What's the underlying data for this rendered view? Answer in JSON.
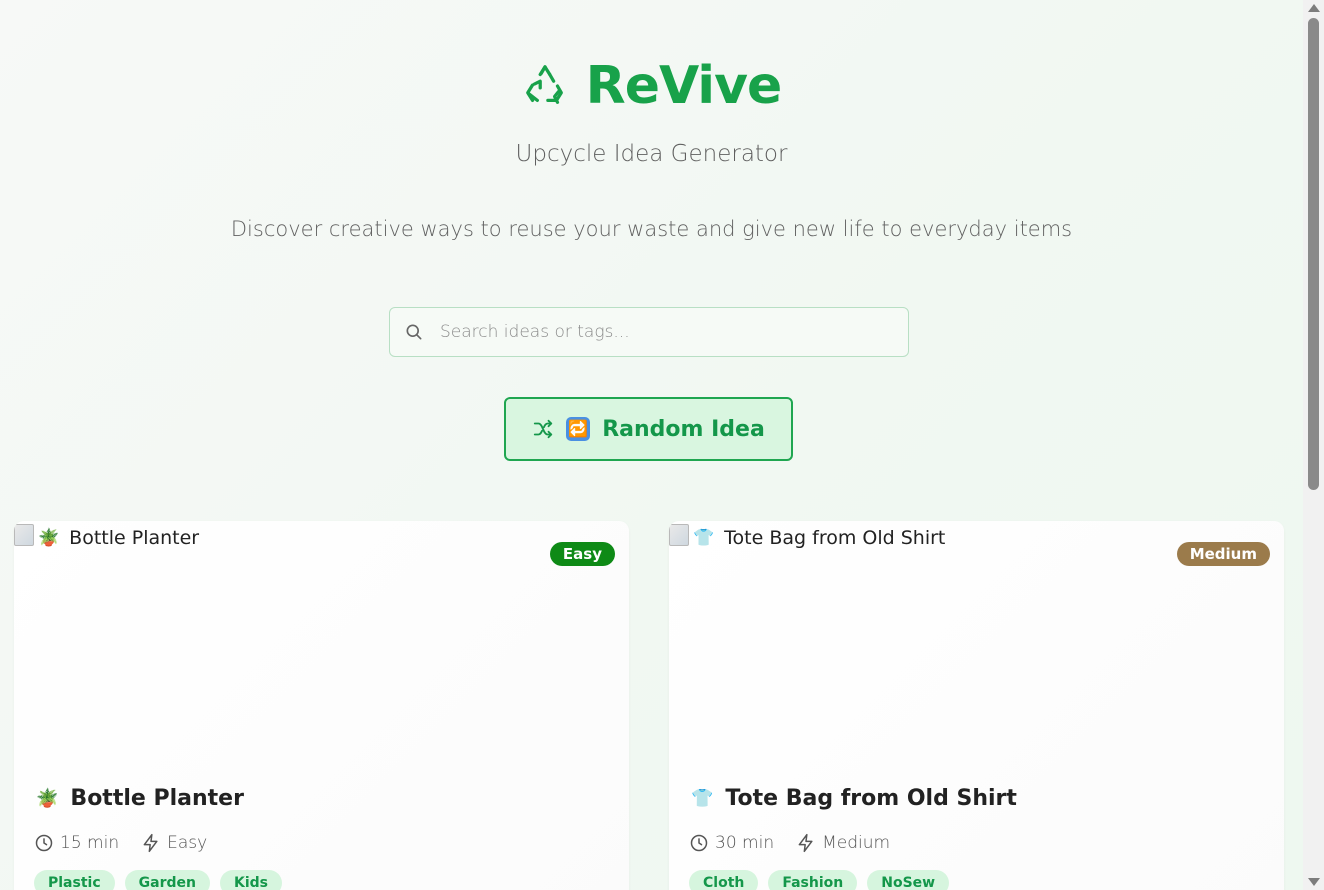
{
  "app": {
    "title": "ReVive",
    "subtitle": "Upcycle Idea Generator",
    "tagline": "Discover creative ways to reuse your waste and give new life to everyday items",
    "accent": "#18a24a"
  },
  "search": {
    "placeholder": "Search ideas or tags...",
    "value": ""
  },
  "random_button": {
    "label": "Random Idea",
    "emoji": "🔁"
  },
  "cards": [
    {
      "image_alt": "Bottle Planter",
      "emoji": "🪴",
      "difficulty_badge": "Easy",
      "badge_color": "#0e8a16",
      "title": "Bottle Planter",
      "time": "15 min",
      "difficulty": "Easy",
      "tags": [
        "Plastic",
        "Garden",
        "Kids"
      ]
    },
    {
      "image_alt": "Tote Bag from Old Shirt",
      "emoji": "👕",
      "difficulty_badge": "Medium",
      "badge_color": "#9b7b4b",
      "title": "Tote Bag from Old Shirt",
      "time": "30 min",
      "difficulty": "Medium",
      "tags": [
        "Cloth",
        "Fashion",
        "NoSew"
      ]
    }
  ]
}
